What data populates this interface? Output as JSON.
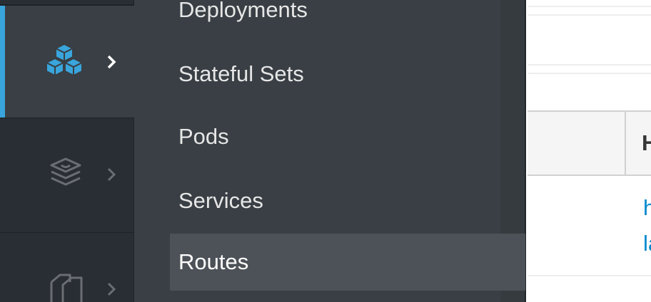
{
  "nav_rail": {
    "items": [
      {
        "icon": "cubes-icon",
        "state": "active",
        "chevron": "chevron-right-icon"
      },
      {
        "icon": "layers-icon",
        "state": "inactive",
        "chevron": "chevron-right-icon"
      },
      {
        "icon": "copy-files-icon",
        "state": "inactive",
        "chevron": "chevron-right-icon"
      }
    ],
    "accent_color": "#39a5dc"
  },
  "submenu": {
    "items": [
      {
        "label": "Deployments"
      },
      {
        "label": "Stateful Sets"
      },
      {
        "label": "Pods"
      },
      {
        "label": "Services"
      },
      {
        "label": "Routes",
        "active": true
      }
    ]
  },
  "content": {
    "column_header": "H",
    "link_lines": [
      "h",
      "la"
    ],
    "link_color": "#0088ce"
  }
}
